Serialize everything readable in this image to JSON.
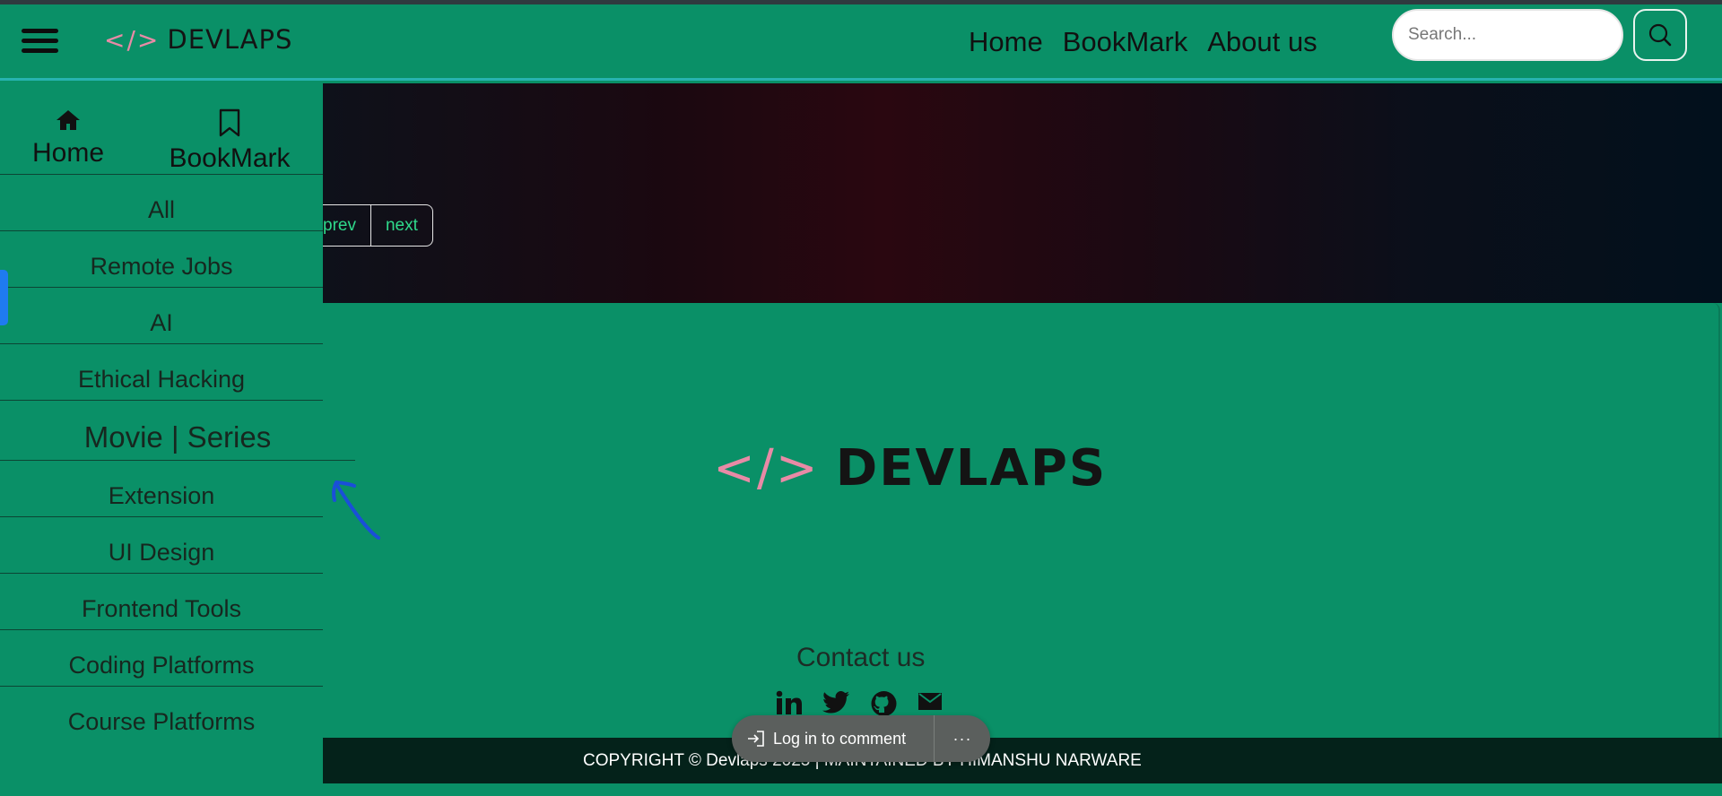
{
  "header": {
    "logo_brackets": "</>",
    "logo_word": "DEVLAPS",
    "nav": [
      "Home",
      "BookMark",
      "About us"
    ],
    "search_placeholder": "Search..."
  },
  "hero": {
    "prev_label": "prev",
    "next_label": "next"
  },
  "sidebar": {
    "top_tabs": [
      {
        "label": "Home",
        "icon": "home-icon"
      },
      {
        "label": "BookMark",
        "icon": "bookmark-icon"
      }
    ],
    "categories": [
      "All",
      "Remote Jobs",
      "AI",
      "Ethical Hacking",
      "Movie | Series",
      "Extension",
      "UI Design",
      "Frontend Tools",
      "Coding Platforms",
      "Course Platforms"
    ],
    "active_category": "Movie | Series"
  },
  "footer": {
    "logo_brackets": "</>",
    "logo_word": "DEVLAPS",
    "contact_title": "Contact us",
    "social_icons": [
      "linkedin-icon",
      "twitter-icon",
      "github-icon",
      "mail-icon"
    ],
    "copyright": "COPYRIGHT © Devlaps 2025 | MAINTAINED BY HIMANSHU NARWARE"
  },
  "comment": {
    "login_label": "Log in to comment",
    "more_label": "···"
  },
  "colors": {
    "primary": "#0a9067",
    "accent_pink": "#e88aa6",
    "link_green": "#2fd98b",
    "dark_bar": "#04221a"
  }
}
